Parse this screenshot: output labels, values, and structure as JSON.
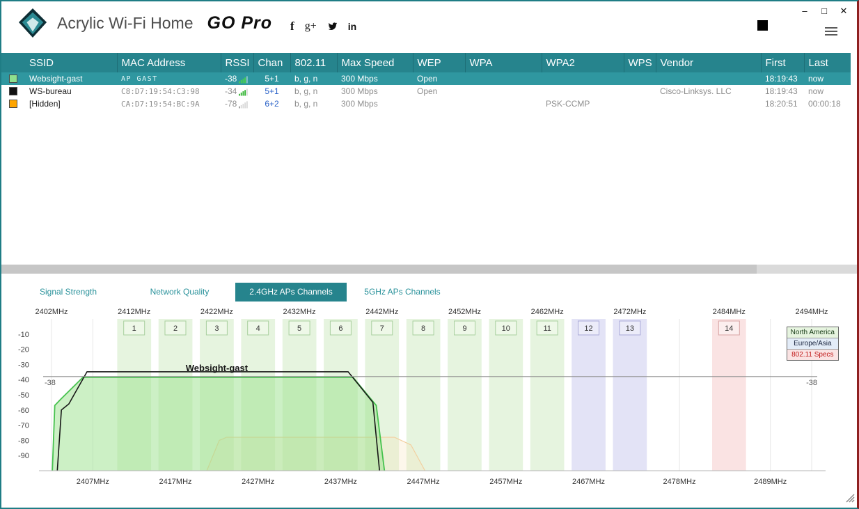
{
  "window": {
    "app_title": "Acrylic Wi-Fi Home",
    "go_pro": "GO Pro",
    "controls": {
      "minimize": "–",
      "maximize": "□",
      "close": "✕"
    }
  },
  "header": {
    "social": [
      {
        "name": "facebook",
        "glyph": "f"
      },
      {
        "name": "google-plus",
        "glyph": "g+"
      },
      {
        "name": "twitter",
        "glyph": ""
      },
      {
        "name": "linkedin",
        "glyph": "in"
      }
    ]
  },
  "table": {
    "columns": [
      "SSID",
      "MAC Address",
      "RSSI",
      "Chan",
      "802.11",
      "Max Speed",
      "WEP",
      "WPA",
      "WPA2",
      "WPS",
      "Vendor",
      "First",
      "Last"
    ],
    "rows": [
      {
        "swatch": "#8ee08e",
        "selected": true,
        "ssid": "Websight-gast",
        "mac": "AP GAST",
        "rssi": "-38",
        "bars": 4,
        "chan": "5+1",
        "dot11": "b, g, n",
        "max_speed": "300 Mbps",
        "wep": "Open",
        "wpa": "",
        "wpa2": "",
        "wps": "",
        "vendor": "",
        "first": "18:19:43",
        "last": "now"
      },
      {
        "swatch": "#111111",
        "selected": false,
        "ssid": "WS-bureau",
        "mac": "C8:D7:19:54:C3:98",
        "rssi": "-34",
        "bars": 4,
        "chan": "5+1",
        "dot11": "b, g, n",
        "max_speed": "300 Mbps",
        "wep": "Open",
        "wpa": "",
        "wpa2": "",
        "wps": "",
        "vendor": "Cisco-Linksys. LLC",
        "first": "18:19:43",
        "last": "now"
      },
      {
        "swatch": "#ffa500",
        "selected": false,
        "ssid": "[Hidden]",
        "mac": "CA:D7:19:54:BC:9A",
        "rssi": "-78",
        "bars": 1,
        "chan": "6+2",
        "dot11": "b, g, n",
        "max_speed": "300 Mbps",
        "wep": "",
        "wpa": "",
        "wpa2": "PSK-CCMP",
        "wps": "",
        "vendor": "",
        "first": "18:20:51",
        "last": "00:00:18"
      }
    ]
  },
  "tabs": [
    {
      "label": "Signal Strength",
      "active": false
    },
    {
      "label": "Network Quality",
      "active": false
    },
    {
      "label": "2.4GHz APs Channels",
      "active": true
    },
    {
      "label": "5GHz APs Channels",
      "active": false
    }
  ],
  "chart_data": {
    "type": "area",
    "title": "2.4GHz APs Channels",
    "x_axis": {
      "unit": "MHz",
      "min": 2402,
      "max": 2494,
      "top_ticks": [
        2402,
        2412,
        2422,
        2432,
        2442,
        2452,
        2462,
        2472,
        2484,
        2494
      ],
      "bottom_ticks": [
        2407,
        2417,
        2427,
        2437,
        2447,
        2457,
        2467,
        2478,
        2489
      ]
    },
    "y_axis": {
      "unit": "dBm",
      "min": -100,
      "max": 0,
      "ticks": [
        -10,
        -20,
        -30,
        -40,
        -50,
        -60,
        -70,
        -80,
        -90
      ]
    },
    "channels": [
      {
        "num": 1,
        "freq": 2412,
        "region": "na"
      },
      {
        "num": 2,
        "freq": 2417,
        "region": "na"
      },
      {
        "num": 3,
        "freq": 2422,
        "region": "na"
      },
      {
        "num": 4,
        "freq": 2427,
        "region": "na"
      },
      {
        "num": 5,
        "freq": 2432,
        "region": "na"
      },
      {
        "num": 6,
        "freq": 2437,
        "region": "na"
      },
      {
        "num": 7,
        "freq": 2442,
        "region": "na"
      },
      {
        "num": 8,
        "freq": 2447,
        "region": "na"
      },
      {
        "num": 9,
        "freq": 2452,
        "region": "na"
      },
      {
        "num": 10,
        "freq": 2457,
        "region": "na"
      },
      {
        "num": 11,
        "freq": 2462,
        "region": "na"
      },
      {
        "num": 12,
        "freq": 2467,
        "region": "eu"
      },
      {
        "num": 13,
        "freq": 2472,
        "region": "eu"
      },
      {
        "num": 14,
        "freq": 2484,
        "region": "spec"
      }
    ],
    "region_colors": {
      "na": {
        "band": "#e6f4df",
        "box": "#eef8e8",
        "border": "#a8cf9e"
      },
      "eu": {
        "band": "#e3e3f6",
        "box": "#ececf9",
        "border": "#a9a9d8"
      },
      "spec": {
        "band": "#fae3e3",
        "box": "#fceeee",
        "border": "#d8a4a4"
      }
    },
    "series": [
      {
        "name": "[Hidden]",
        "color": "#f2cf9f",
        "fill": "rgba(248,228,190,0.30)",
        "width": 1.2,
        "points": [
          [
            2420.8,
            -100
          ],
          [
            2422.3,
            -80
          ],
          [
            2423.2,
            -78
          ],
          [
            2443.5,
            -78
          ],
          [
            2445.5,
            -83
          ],
          [
            2447.2,
            -100
          ]
        ]
      },
      {
        "name": "Websight-gast",
        "color": "#46c24e",
        "fill": "rgba(154,225,140,0.50)",
        "width": 1.8,
        "points": [
          [
            2402.1,
            -100
          ],
          [
            2402.4,
            -57
          ],
          [
            2403.1,
            -53
          ],
          [
            2405.8,
            -38.5
          ],
          [
            2438.5,
            -38.5
          ],
          [
            2441.3,
            -57
          ],
          [
            2442.3,
            -100
          ]
        ]
      },
      {
        "name": "WS-bureau",
        "color": "#161616",
        "fill": "none",
        "width": 1.6,
        "points": [
          [
            2402.7,
            -100
          ],
          [
            2403.2,
            -60
          ],
          [
            2404.1,
            -56
          ],
          [
            2406.3,
            -34.8
          ],
          [
            2437.9,
            -34.8
          ],
          [
            2440.9,
            -55
          ],
          [
            2441.7,
            -100
          ]
        ]
      }
    ],
    "ref_line": {
      "value": -38,
      "label": "-38",
      "color": "#8f8f8f"
    },
    "annotation": {
      "text": "Websight-gast",
      "freq": 2422,
      "dbm": -34.5
    },
    "legend": [
      {
        "label": "North America",
        "bg": "#e6f4df",
        "color": "#143814"
      },
      {
        "label": "Europe/Asia",
        "bg": "#e3ecf8",
        "color": "#16213c"
      },
      {
        "label": "802.11 Specs",
        "bg": "#fae3e3",
        "color": "#c01818"
      }
    ]
  }
}
